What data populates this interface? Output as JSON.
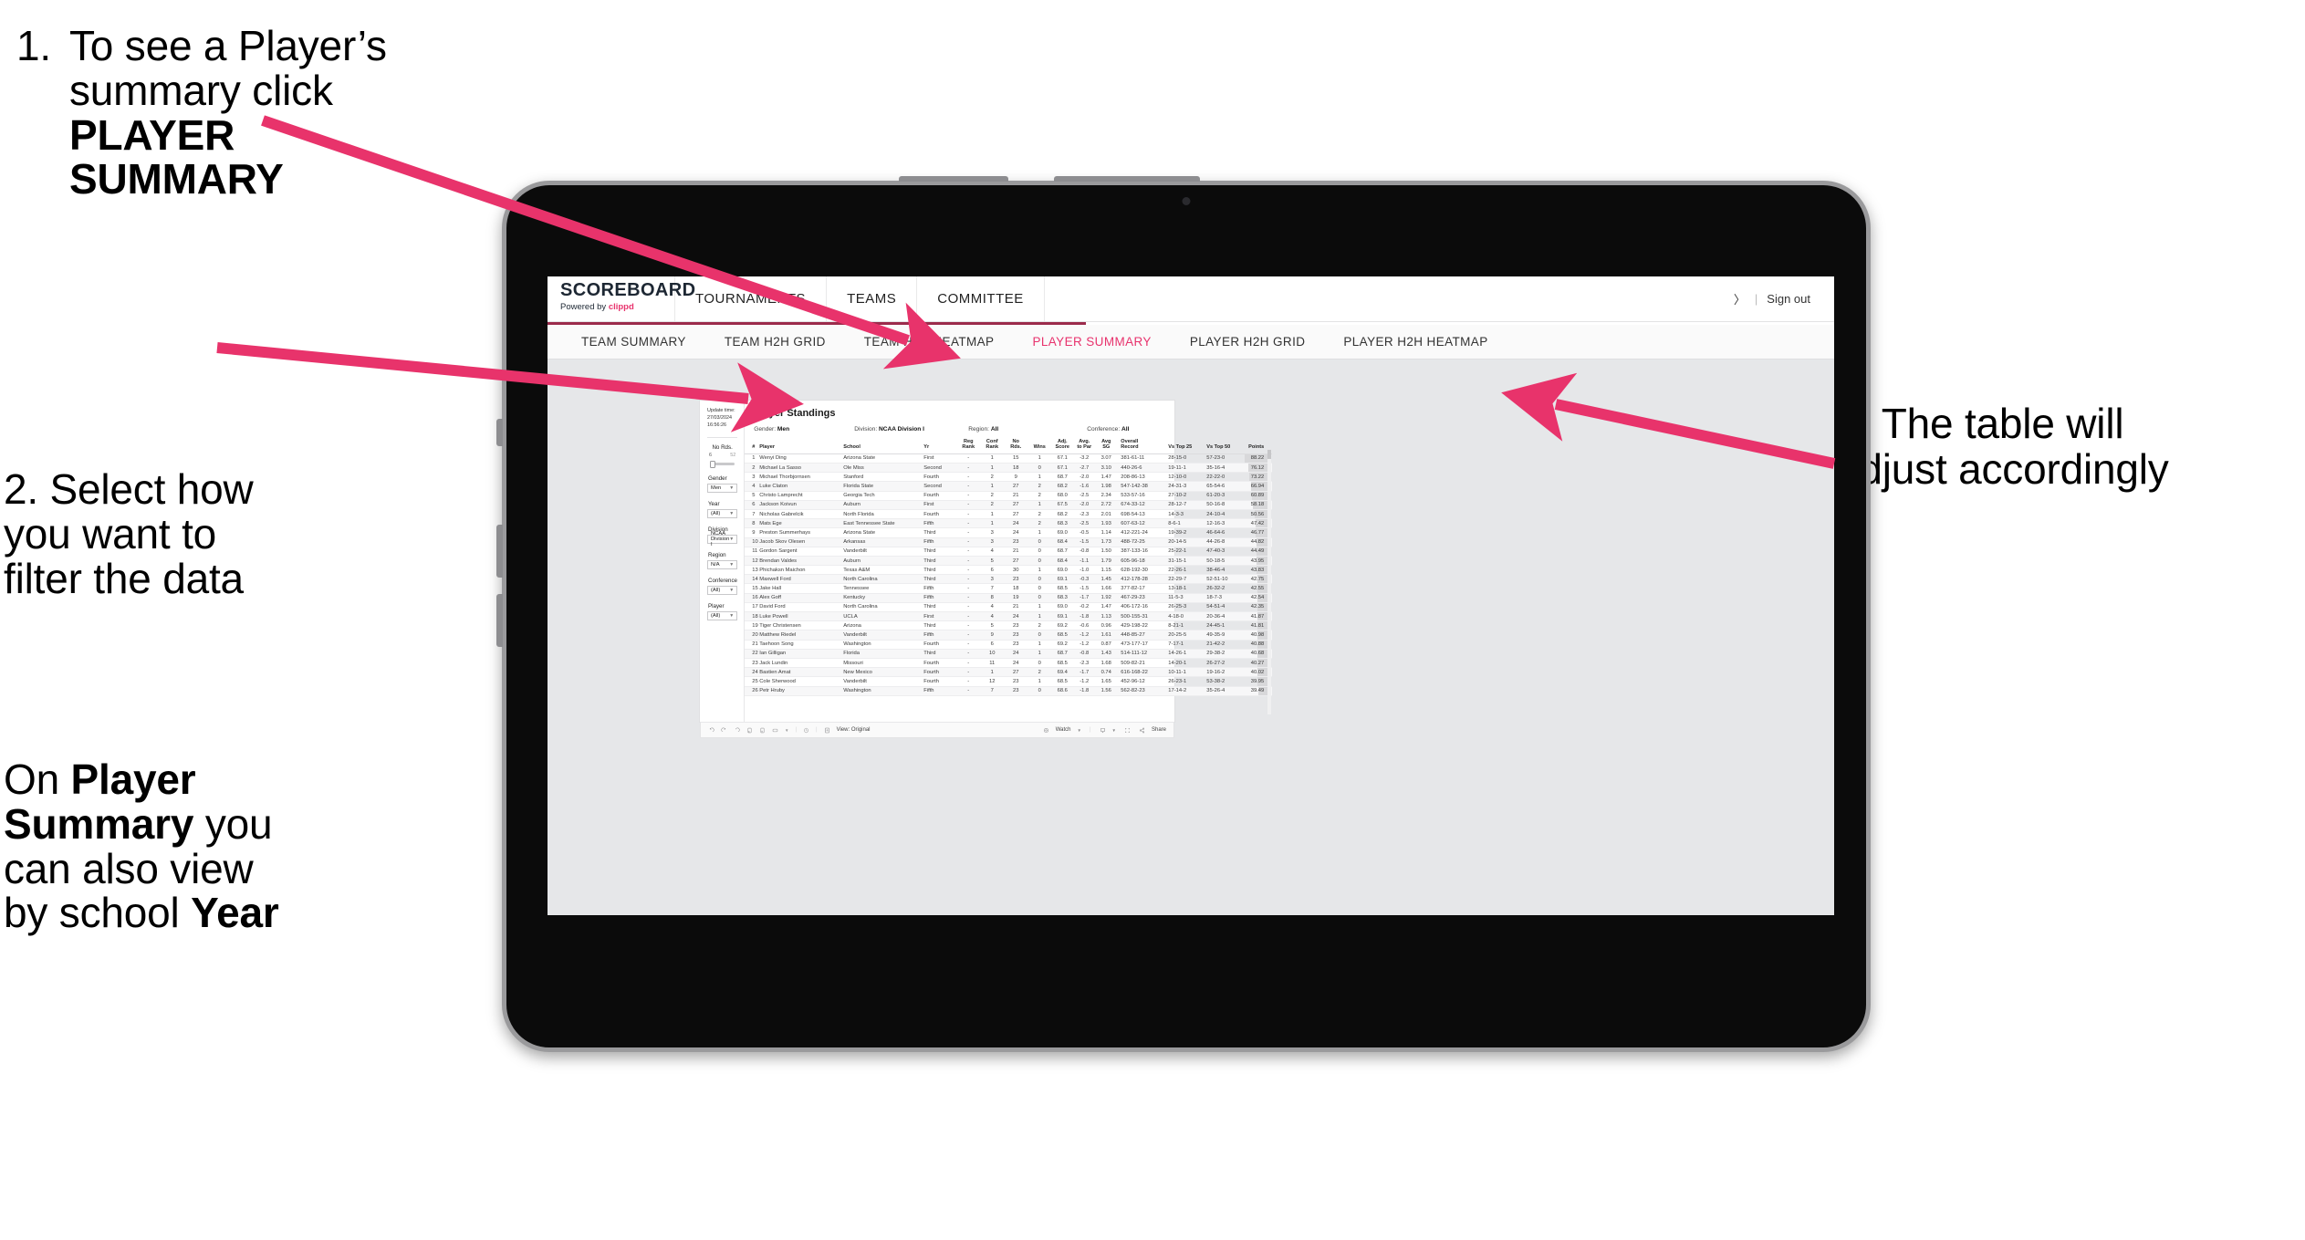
{
  "annotations": {
    "one_num": "1.",
    "one_a": "To see a Player’s",
    "one_b": "summary click ",
    "one_bold": "PLAYER",
    "one_bold2": "SUMMARY",
    "two": "2. Select how\nyou want to\nfilter the data",
    "three_a": "On ",
    "three_b1": "Player",
    "three_b2": "Summary",
    "three_c": " you",
    "three_d": "can also view",
    "three_e": "by school ",
    "three_f": "Year",
    "four_a": "3. The table will",
    "four_b": "adjust accordingly"
  },
  "colors": {
    "accent_pink": "#e8336d",
    "arrow_pink": "#e8336b",
    "brand_underline": "#9b2b4b",
    "screen_bg": "#e6e7e9"
  },
  "brand": {
    "logo_word": "SCOREBOARD",
    "logo_powered": "Powered by ",
    "logo_clippd": "clippd",
    "top_nav": [
      "TOURNAMENTS",
      "TEAMS",
      "COMMITTEE"
    ],
    "account_icon": "〉",
    "divider": "|",
    "sign_out": "Sign out"
  },
  "subnav": {
    "items": [
      {
        "label": "TEAM SUMMARY",
        "active": false
      },
      {
        "label": "TEAM H2H GRID",
        "active": false
      },
      {
        "label": "TEAM H2H HEATMAP",
        "active": false
      },
      {
        "label": "PLAYER SUMMARY",
        "active": true
      },
      {
        "label": "PLAYER H2H GRID",
        "active": false
      },
      {
        "label": "PLAYER H2H HEATMAP",
        "active": false
      }
    ]
  },
  "filters": {
    "update_label": "Update time:",
    "update_value": "27/03/2024 16:56:26",
    "slider": {
      "title": "No Rds.",
      "min": "6",
      "max": "52"
    },
    "selects": [
      {
        "label": "Gender",
        "value": "Men"
      },
      {
        "label": "Year",
        "value": "(All)"
      },
      {
        "label": "Division",
        "value": "NCAA Division I"
      },
      {
        "label": "Region",
        "value": "N/A"
      },
      {
        "label": "Conference",
        "value": "(All)"
      },
      {
        "label": "Player",
        "value": "(All)"
      }
    ],
    "caret": "▼"
  },
  "panel": {
    "title": "Player Standings",
    "meta": [
      {
        "key": "Gender: ",
        "value": "Men"
      },
      {
        "key": "Division: ",
        "value": "NCAA Division I"
      },
      {
        "key": "Region: ",
        "value": "All"
      },
      {
        "key": "Conference: ",
        "value": "All"
      }
    ]
  },
  "table": {
    "headers": [
      {
        "l1": "#",
        "l2": "",
        "cls": "c-rank"
      },
      {
        "l1": "Player",
        "l2": "",
        "cls": "c-player"
      },
      {
        "l1": "School",
        "l2": "",
        "cls": "c-school"
      },
      {
        "l1": "Yr",
        "l2": "",
        "cls": "c-yr"
      },
      {
        "l1": "Reg",
        "l2": "Rank",
        "cls": "c-n"
      },
      {
        "l1": "Conf",
        "l2": "Rank",
        "cls": "c-n"
      },
      {
        "l1": "No",
        "l2": "Rds.",
        "cls": "c-n"
      },
      {
        "l1": "Wins",
        "l2": "",
        "cls": "c-n"
      },
      {
        "l1": "Adj.",
        "l2": "Score",
        "cls": "c-num"
      },
      {
        "l1": "Avg.",
        "l2": "to Par",
        "cls": "c-num"
      },
      {
        "l1": "Avg",
        "l2": "SG",
        "cls": "c-num"
      },
      {
        "l1": "Overall",
        "l2": "Record",
        "cls": "c-rec"
      },
      {
        "l1": "Vs Top 25",
        "l2": "",
        "cls": "c-vs"
      },
      {
        "l1": "Vs Top 50",
        "l2": "",
        "cls": "c-vs"
      },
      {
        "l1": "Points",
        "l2": "",
        "cls": "c-pts"
      }
    ],
    "rows": [
      [
        "1",
        "Wenyi Ding",
        "Arizona State",
        "First",
        "-",
        "1",
        "15",
        "1",
        "67.1",
        "-3.2",
        "3.07",
        "381-61-11",
        "28-15-0",
        "57-23-0",
        "88.22"
      ],
      [
        "2",
        "Michael La Sasso",
        "Ole Miss",
        "Second",
        "-",
        "1",
        "18",
        "0",
        "67.1",
        "-2.7",
        "3.10",
        "440-26-6",
        "19-11-1",
        "35-16-4",
        "76.12"
      ],
      [
        "3",
        "Michael Thorbjornsen",
        "Stanford",
        "Fourth",
        "-",
        "2",
        "9",
        "1",
        "68.7",
        "-2.0",
        "1.47",
        "208-86-13",
        "12-10-0",
        "22-22-0",
        "73.22"
      ],
      [
        "4",
        "Luke Claton",
        "Florida State",
        "Second",
        "-",
        "1",
        "27",
        "2",
        "68.2",
        "-1.6",
        "1.98",
        "547-142-38",
        "24-31-3",
        "65-54-6",
        "66.94"
      ],
      [
        "5",
        "Christo Lamprecht",
        "Georgia Tech",
        "Fourth",
        "-",
        "2",
        "21",
        "2",
        "68.0",
        "-2.5",
        "2.34",
        "533-57-16",
        "27-10-2",
        "61-20-3",
        "60.89"
      ],
      [
        "6",
        "Jackson Koivun",
        "Auburn",
        "First",
        "-",
        "2",
        "27",
        "1",
        "67.5",
        "-2.0",
        "2.72",
        "674-33-12",
        "28-12-7",
        "50-16-8",
        "58.18"
      ],
      [
        "7",
        "Nicholas Gabrelcik",
        "North Florida",
        "Fourth",
        "-",
        "1",
        "27",
        "2",
        "68.2",
        "-2.3",
        "2.01",
        "698-54-13",
        "14-3-3",
        "24-10-4",
        "50.56"
      ],
      [
        "8",
        "Mats Ege",
        "East Tennessee State",
        "Fifth",
        "-",
        "1",
        "24",
        "2",
        "68.3",
        "-2.5",
        "1.93",
        "607-63-12",
        "8-6-1",
        "12-16-3",
        "47.42"
      ],
      [
        "9",
        "Preston Summerhays",
        "Arizona State",
        "Third",
        "-",
        "3",
        "24",
        "1",
        "69.0",
        "-0.5",
        "1.14",
        "412-221-24",
        "19-39-2",
        "46-64-6",
        "46.77"
      ],
      [
        "10",
        "Jacob Skov Olesen",
        "Arkansas",
        "Fifth",
        "-",
        "3",
        "23",
        "0",
        "68.4",
        "-1.5",
        "1.73",
        "488-72-25",
        "20-14-5",
        "44-26-8",
        "44.82"
      ],
      [
        "11",
        "Gordon Sargent",
        "Vanderbilt",
        "Third",
        "-",
        "4",
        "21",
        "0",
        "68.7",
        "-0.8",
        "1.50",
        "387-133-16",
        "25-22-1",
        "47-40-3",
        "44.49"
      ],
      [
        "12",
        "Brendan Valdes",
        "Auburn",
        "Third",
        "-",
        "5",
        "27",
        "0",
        "68.4",
        "-1.1",
        "1.79",
        "605-96-18",
        "31-15-1",
        "50-18-5",
        "43.95"
      ],
      [
        "13",
        "Phichaksn Maichon",
        "Texas A&M",
        "Third",
        "-",
        "6",
        "30",
        "1",
        "69.0",
        "-1.0",
        "1.15",
        "628-192-30",
        "22-26-1",
        "38-46-4",
        "43.83"
      ],
      [
        "14",
        "Maxwell Ford",
        "North Carolina",
        "Third",
        "-",
        "3",
        "23",
        "0",
        "69.1",
        "-0.3",
        "1.45",
        "412-178-28",
        "22-29-7",
        "52-51-10",
        "42.75"
      ],
      [
        "15",
        "Jake Hall",
        "Tennessee",
        "Fifth",
        "-",
        "7",
        "18",
        "0",
        "68.5",
        "-1.5",
        "1.66",
        "377-82-17",
        "13-18-1",
        "26-32-2",
        "42.55"
      ],
      [
        "16",
        "Alex Goff",
        "Kentucky",
        "Fifth",
        "-",
        "8",
        "19",
        "0",
        "68.3",
        "-1.7",
        "1.92",
        "467-29-23",
        "11-5-3",
        "18-7-3",
        "42.54"
      ],
      [
        "17",
        "David Ford",
        "North Carolina",
        "Third",
        "-",
        "4",
        "21",
        "1",
        "69.0",
        "-0.2",
        "1.47",
        "406-172-16",
        "26-25-3",
        "54-51-4",
        "42.35"
      ],
      [
        "18",
        "Luke Powell",
        "UCLA",
        "First",
        "-",
        "4",
        "24",
        "1",
        "69.1",
        "-1.8",
        "1.13",
        "500-155-31",
        "4-18-0",
        "20-36-4",
        "41.87"
      ],
      [
        "19",
        "Tiger Christensen",
        "Arizona",
        "Third",
        "-",
        "5",
        "23",
        "2",
        "69.2",
        "-0.6",
        "0.96",
        "429-198-22",
        "8-21-1",
        "24-45-1",
        "41.81"
      ],
      [
        "20",
        "Matthew Riedel",
        "Vanderbilt",
        "Fifth",
        "-",
        "9",
        "23",
        "0",
        "68.5",
        "-1.2",
        "1.61",
        "448-85-27",
        "20-25-5",
        "49-35-9",
        "40.98"
      ],
      [
        "21",
        "Taehoon Song",
        "Washington",
        "Fourth",
        "-",
        "6",
        "23",
        "1",
        "69.2",
        "-1.2",
        "0.87",
        "473-177-17",
        "7-17-1",
        "21-42-2",
        "40.88"
      ],
      [
        "22",
        "Ian Gilligan",
        "Florida",
        "Third",
        "-",
        "10",
        "24",
        "1",
        "68.7",
        "-0.8",
        "1.43",
        "514-111-12",
        "14-26-1",
        "29-38-2",
        "40.68"
      ],
      [
        "23",
        "Jack Lundin",
        "Missouri",
        "Fourth",
        "-",
        "11",
        "24",
        "0",
        "68.5",
        "-2.3",
        "1.68",
        "509-82-21",
        "14-20-1",
        "26-27-2",
        "40.27"
      ],
      [
        "24",
        "Bastien Amat",
        "New Mexico",
        "Fourth",
        "-",
        "1",
        "27",
        "2",
        "69.4",
        "-1.7",
        "0.74",
        "616-168-22",
        "10-11-1",
        "19-16-2",
        "40.02"
      ],
      [
        "25",
        "Cole Sherwood",
        "Vanderbilt",
        "Fourth",
        "-",
        "12",
        "23",
        "1",
        "68.5",
        "-1.2",
        "1.65",
        "452-96-12",
        "26-23-1",
        "53-38-2",
        "39.95"
      ],
      [
        "26",
        "Petr Hruby",
        "Washington",
        "Fifth",
        "-",
        "7",
        "23",
        "0",
        "68.6",
        "-1.8",
        "1.56",
        "562-82-23",
        "17-14-2",
        "35-26-4",
        "39.49"
      ]
    ],
    "points_max": 88.22
  },
  "toolbar": {
    "left_icons": [
      "undo-icon",
      "redo-icon",
      "revert-icon",
      "refresh-data-icon",
      "pause-icon",
      "view-layout-icon",
      "caret-down-icon"
    ],
    "clock_icon": "◷",
    "view_label": "View: Original",
    "watch_label": "Watch",
    "share_label": "Share"
  }
}
